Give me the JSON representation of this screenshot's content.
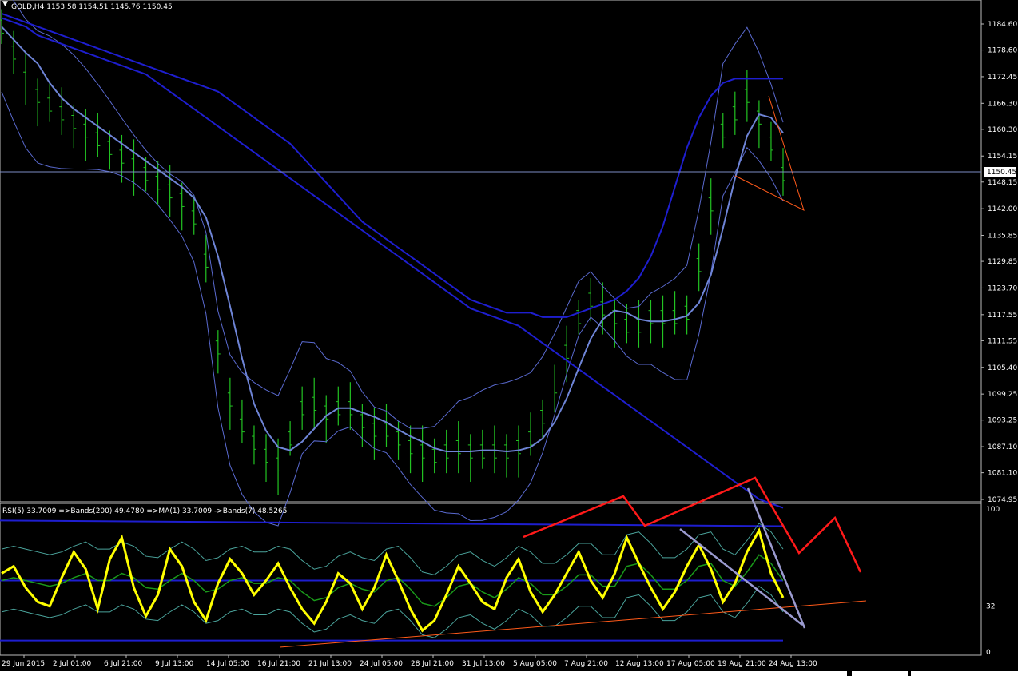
{
  "chart_data": [
    {
      "type": "line",
      "symbol_header": "GOLD,H4  1153.58 1154.51 1145.76 1150.45",
      "current_price_label": "1150.45",
      "price_ticks": [
        "1184.60",
        "1178.60",
        "1172.45",
        "1166.30",
        "1160.30",
        "1154.15",
        "1148.15",
        "1142.00",
        "1135.85",
        "1129.85",
        "1123.70",
        "1117.55",
        "1111.55",
        "1105.40",
        "1099.25",
        "1093.25",
        "1087.10",
        "1081.10",
        "1074.95"
      ],
      "ylim": [
        1074.95,
        1184.6
      ],
      "series": [
        {
          "kind": "price",
          "y": [
            1184,
            1178,
            1172,
            1168,
            1166,
            1164,
            1162,
            1160,
            1158,
            1156,
            1154,
            1152,
            1150,
            1148,
            1146,
            1144,
            1140,
            1130,
            1110,
            1098,
            1092,
            1088,
            1085,
            1083,
            1089,
            1096,
            1097,
            1095,
            1096,
            1096,
            1093,
            1091,
            1091,
            1089,
            1087,
            1086,
            1085,
            1086,
            1087,
            1086,
            1086,
            1086,
            1086,
            1087,
            1089,
            1094,
            1101,
            1109,
            1117,
            1121,
            1119,
            1117,
            1115,
            1115,
            1117,
            1117,
            1117,
            1118,
            1129,
            1143,
            1160,
            1164,
            1168,
            1163,
            1157,
            1150
          ]
        },
        {
          "kind": "ma_slow",
          "y": [
            1186,
            1185,
            1184,
            1182,
            1181,
            1180,
            1179,
            1178,
            1177,
            1176,
            1175,
            1174,
            1173,
            1171,
            1169,
            1167,
            1165,
            1163,
            1161,
            1159,
            1157,
            1155,
            1153,
            1151,
            1149,
            1147,
            1145,
            1143,
            1141,
            1139,
            1137,
            1135,
            1133,
            1131,
            1129,
            1127,
            1125,
            1123,
            1121,
            1119,
            1118,
            1117,
            1116,
            1115,
            1113,
            1111,
            1109,
            1107,
            1105,
            1103,
            1101,
            1099,
            1097,
            1095,
            1093,
            1091,
            1089,
            1087,
            1085,
            1083,
            1081,
            1079,
            1077,
            1075,
            1074,
            1073
          ]
        },
        {
          "kind": "ma_long",
          "y": [
            1187,
            1186,
            1185,
            1184,
            1183,
            1182,
            1181,
            1180,
            1179,
            1178,
            1177,
            1176,
            1175,
            1174,
            1173,
            1172,
            1171,
            1170,
            1169,
            1167,
            1165,
            1163,
            1161,
            1159,
            1157,
            1154,
            1151,
            1148,
            1145,
            1142,
            1139,
            1137,
            1135,
            1133,
            1131,
            1129,
            1127,
            1125,
            1123,
            1121,
            1120,
            1119,
            1118,
            1118,
            1118,
            1117,
            1117,
            1117,
            1118,
            1119,
            1120,
            1121,
            1123,
            1126,
            1131,
            1138,
            1147,
            1156,
            1163,
            1168,
            1171,
            1172,
            1172,
            1172,
            1172,
            1172
          ]
        }
      ]
    },
    {
      "type": "line",
      "header": "RSI(5) 33.7009  =>Bands(200) 49.4780  =>MA(1) 33.7009  ->Bands(7) 48.5265",
      "ticks": [
        "100",
        "32",
        "0"
      ],
      "ylim": [
        0,
        100
      ],
      "series": [
        {
          "kind": "rsi",
          "y": [
            55,
            60,
            45,
            35,
            32,
            52,
            70,
            58,
            30,
            65,
            80,
            45,
            25,
            40,
            72,
            60,
            35,
            22,
            48,
            65,
            55,
            40,
            50,
            62,
            45,
            30,
            20,
            35,
            55,
            48,
            30,
            45,
            68,
            50,
            30,
            15,
            22,
            40,
            60,
            48,
            35,
            30,
            52,
            65,
            42,
            28,
            40,
            55,
            70,
            50,
            38,
            55,
            80,
            62,
            45,
            30,
            42,
            60,
            75,
            58,
            35,
            48,
            70,
            85,
            55,
            38
          ]
        },
        {
          "kind": "bands_ma",
          "y": [
            50,
            52,
            50,
            48,
            46,
            48,
            52,
            55,
            50,
            50,
            55,
            52,
            45,
            44,
            50,
            55,
            50,
            42,
            44,
            50,
            52,
            48,
            48,
            52,
            50,
            42,
            36,
            38,
            45,
            48,
            44,
            42,
            50,
            52,
            44,
            34,
            32,
            38,
            46,
            48,
            42,
            38,
            44,
            52,
            48,
            40,
            40,
            46,
            54,
            54,
            46,
            46,
            60,
            62,
            54,
            44,
            44,
            50,
            60,
            62,
            50,
            46,
            56,
            68,
            62,
            50
          ]
        }
      ]
    }
  ],
  "time_labels": [
    "29 Jun 2015",
    "2 Jul 01:00",
    "6 Jul 21:00",
    "9 Jul 13:00",
    "14 Jul 05:00",
    "16 Jul 21:00",
    "21 Jul 13:00",
    "24 Jul 05:00",
    "28 Jul 21:00",
    "31 Jul 13:00",
    "5 Aug 05:00",
    "7 Aug 21:00",
    "12 Aug 13:00",
    "17 Aug 05:00",
    "19 Aug 21:00",
    "24 Aug 13:00"
  ],
  "colors": {
    "background": "#000000",
    "candles": "#22c322",
    "ma_blue": "#1e1ecf",
    "ma_light": "#6e84d6",
    "bands": "#5a6ad0",
    "rsi": "#ffff00",
    "rsi_ma": "#1a9a1a",
    "rsi_bands": "#4aa39b",
    "annotation_red": "#ff1a1a",
    "annotation_gray": "#9b9bd0",
    "trend_orange": "#ff5a1a"
  }
}
